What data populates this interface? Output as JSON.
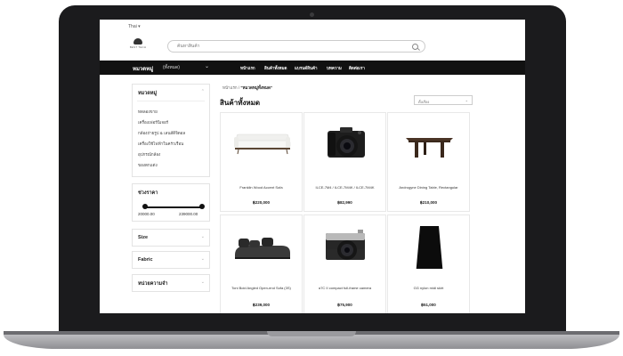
{
  "topbar": {
    "language": "Thai ▾",
    "logo_text": "BEST TECH"
  },
  "search": {
    "placeholder": "ค้นหาสินค้า"
  },
  "nav": {
    "category_label": "หมวดหมู่",
    "category_sub": "(ทั้งหมด)",
    "items": [
      "หน้าแรก",
      "สินค้าทั้งหมด",
      "แบรนด์สินค้า",
      "บทความ",
      "ติดต่อเรา"
    ]
  },
  "sidebar": {
    "categories_title": "หมวดหมู่",
    "categories": [
      "ทดลองขาย",
      "เครื่องเฟอร์นิเจอร์",
      "กล้องถ่ายรูป & เลนส์ดิจิตอล",
      "เครื่องใช้ไฟฟ้าในครัวเรือน",
      "อุปกรณ์กล้อง",
      "ของตกแต่ง"
    ],
    "price_title": "ช่วงราคา",
    "price_min": "20000.00",
    "price_max": "239000.00",
    "filters": [
      "Size",
      "Fabric",
      "หน่วยความจำ"
    ]
  },
  "breadcrumb": {
    "home": "หน้าแรก",
    "sep": "/",
    "current": "\"หมวดหมู่ทั้งหมด\""
  },
  "page_title": "สินค้าทั้งหมด",
  "sort": {
    "label": "ตั้งเรียง"
  },
  "products": [
    {
      "name": "Franklin Wood Accent Sofa",
      "price": "฿220,000"
    },
    {
      "name": "ILCE-7M4 / ILCE-7M4K / ILCE-7M4K",
      "price": "฿82,990"
    },
    {
      "name": "Androgyne Dining Table, Rectangular",
      "price": "฿210,000"
    },
    {
      "name": "Toni Bold Angled Open-end Sofa (3S)",
      "price": "฿239,000"
    },
    {
      "name": "α7C II compact full-frame camera",
      "price": "฿75,900"
    },
    {
      "name": "GG nylon midi skirt",
      "price": "฿51,000"
    }
  ]
}
